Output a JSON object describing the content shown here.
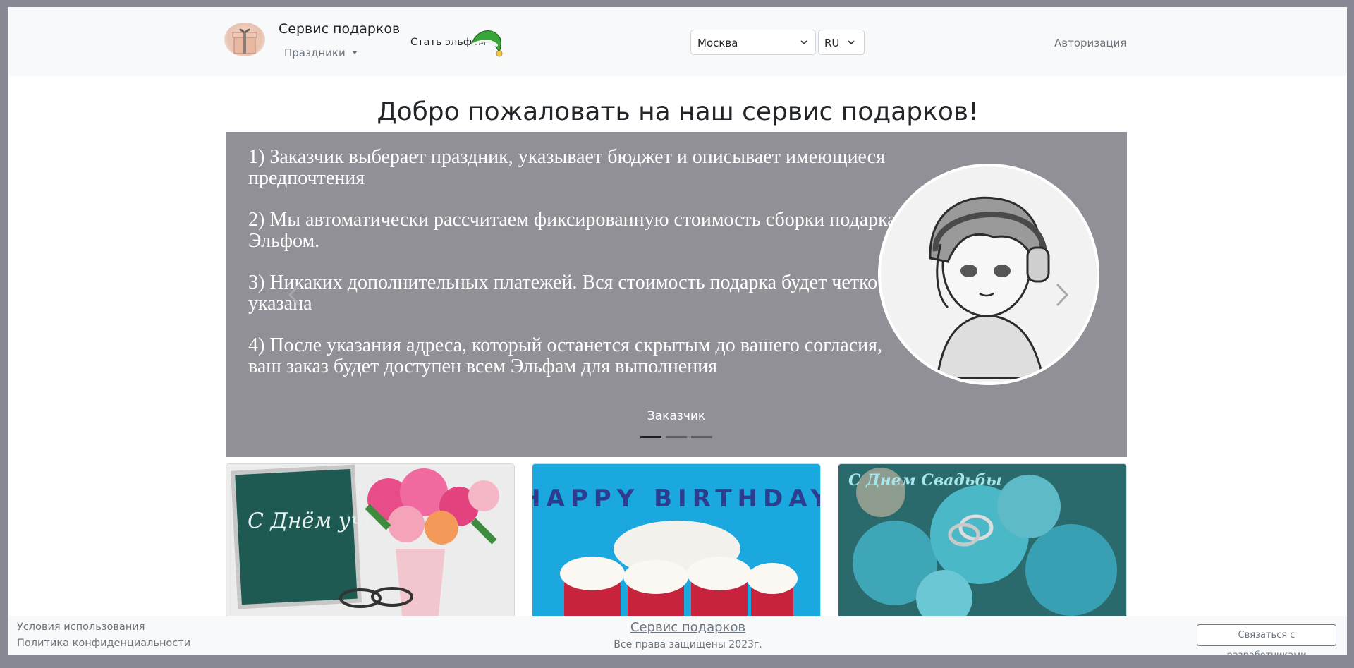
{
  "header": {
    "brand": "Сервис подарков",
    "holidays_menu": "Праздники",
    "become_elf": "Стать эльфом",
    "city": "Москва",
    "language": "RU",
    "login": "Авторизация"
  },
  "main": {
    "title": "Добро пожаловать на наш сервис подарков!",
    "carousel": {
      "slide_lines": [
        "1) Заказчик выберает праздник, указывает бюджет и описывает имеющиеся предпочтения",
        "2) Мы автоматически рассчитаем фиксированную стоимость сборки подарка Эльфом.",
        "3) Никаких дополнительных платежей. Вся стоимость подарка будет четко указана",
        "4) После указания адреса, который останется скрытым до вашего согласия, ваш заказ будет доступен всем Эльфам для выполнения"
      ],
      "caption": "Заказчик",
      "active_index": 0,
      "slides_count": 3
    },
    "cards": [
      {
        "image_text": "С Днём учителя"
      },
      {
        "image_text": "HAPPY BIRTHDAY"
      },
      {
        "image_text": "С Днем Свадьбы"
      }
    ]
  },
  "footer": {
    "terms": "Условия использования",
    "privacy": "Политика конфиденциальности",
    "brand": "Сервис подарков",
    "rights": "Все права защищены 2023г.",
    "contact_button": "Связаться с разработчиками"
  },
  "colors": {
    "page_bg": "#868893",
    "navbar_bg": "#f8f9fa",
    "carousel_bg": "#909096",
    "muted_text": "#6c757d"
  }
}
